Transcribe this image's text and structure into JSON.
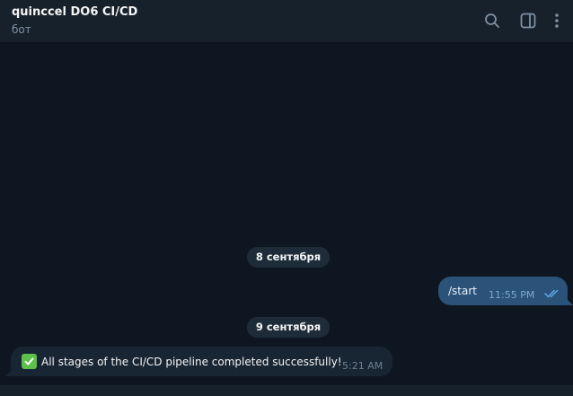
{
  "header": {
    "title": "quinccel DO6 CI/CD",
    "subtitle": "бот",
    "search_icon": "search-icon",
    "panel_icon": "sidebar-panel-icon",
    "more_icon": "more-vertical-icon"
  },
  "messages": [
    {
      "date": "8 сентября",
      "direction": "outgoing",
      "text": "/start",
      "time": "11:55 PM",
      "status": "read"
    },
    {
      "date": "9 сентября",
      "direction": "incoming",
      "emoji": "✅",
      "text": "All stages of the CI/CD pipeline completed successfully!",
      "time": "5:21 AM"
    }
  ],
  "colors": {
    "background": "#0e1621",
    "header": "#17212b",
    "outgoing_bubble": "#2b5278",
    "incoming_bubble": "#182533",
    "date_pill": "#1e2c3a",
    "accent": "#5fa8e8"
  }
}
